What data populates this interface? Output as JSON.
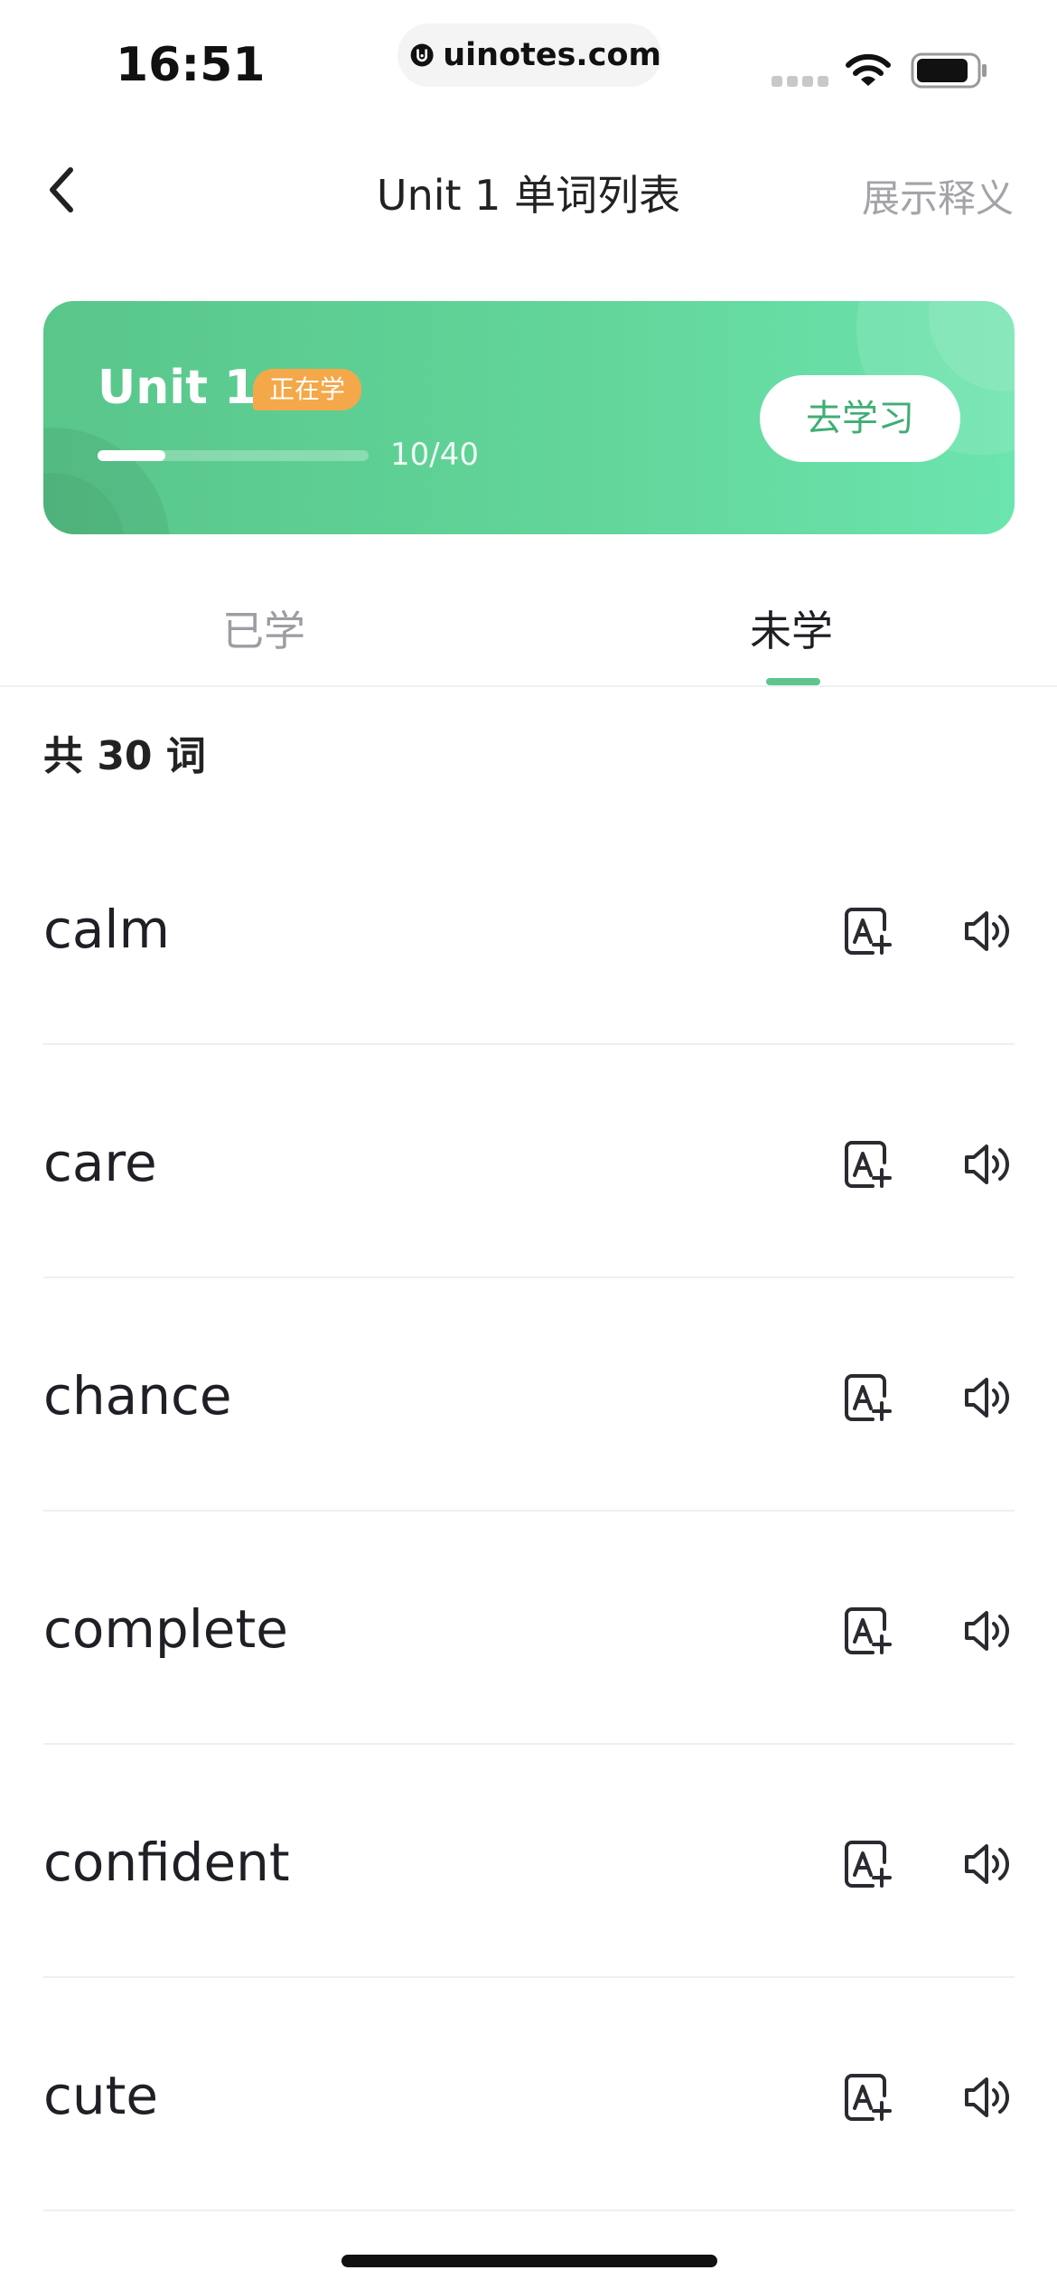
{
  "status_bar": {
    "time": "16:51",
    "url": "uinotes.com",
    "icons": [
      "signal-icon",
      "wifi-icon",
      "battery-icon"
    ]
  },
  "nav": {
    "title": "Unit 1 单词列表",
    "action": "展示释义",
    "back_icon": "chevron-left-icon"
  },
  "unit_card": {
    "name": "Unit 1",
    "badge": "正在学",
    "progress_text": "10/40",
    "progress_fraction": 0.25,
    "button_label": "去学习"
  },
  "tabs": [
    {
      "label": "已学",
      "active": false
    },
    {
      "label": "未学",
      "active": true
    }
  ],
  "word_count": "共 30 词",
  "words": [
    {
      "text": "calm"
    },
    {
      "text": "care"
    },
    {
      "text": "chance"
    },
    {
      "text": "complete"
    },
    {
      "text": "confident"
    },
    {
      "text": "cute"
    }
  ],
  "colors": {
    "accent": "#5cc68e",
    "badge": "#f4a849",
    "card_start": "#59c68a",
    "card_end": "#6ce4ae",
    "button_text": "#3fae72"
  },
  "row_icons": [
    "add-word-icon",
    "speaker-icon"
  ]
}
